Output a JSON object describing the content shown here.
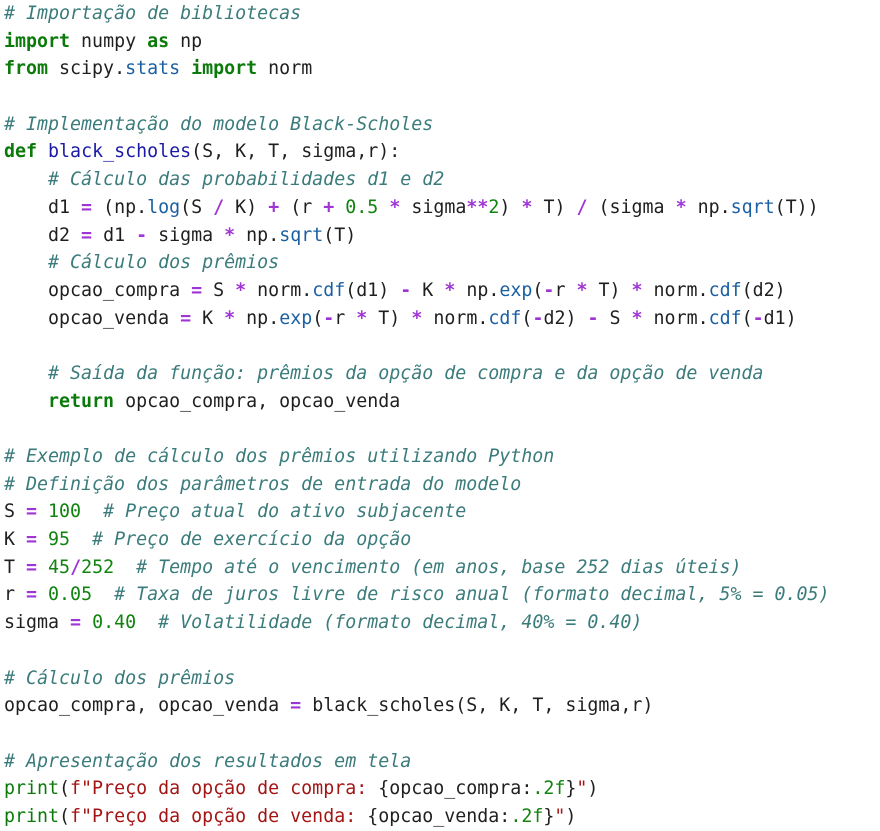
{
  "editor": {
    "language": "python",
    "lines": [
      [
        {
          "t": "cm",
          "v": "# Importação de bibliotecas"
        }
      ],
      [
        {
          "t": "kw",
          "v": "import"
        },
        {
          "t": "p",
          "v": " numpy "
        },
        {
          "t": "kw",
          "v": "as"
        },
        {
          "t": "p",
          "v": " np"
        }
      ],
      [
        {
          "t": "kw",
          "v": "from"
        },
        {
          "t": "p",
          "v": " scipy."
        },
        {
          "t": "attr",
          "v": "stats"
        },
        {
          "t": "p",
          "v": " "
        },
        {
          "t": "kw",
          "v": "import"
        },
        {
          "t": "p",
          "v": " norm"
        }
      ],
      [],
      [
        {
          "t": "cm",
          "v": "# Implementação do modelo Black-Scholes"
        }
      ],
      [
        {
          "t": "kw",
          "v": "def"
        },
        {
          "t": "p",
          "v": " "
        },
        {
          "t": "fn",
          "v": "black_scholes"
        },
        {
          "t": "p",
          "v": "(S, K, T, sigma,r):"
        }
      ],
      [
        {
          "t": "p",
          "v": "    "
        },
        {
          "t": "cm",
          "v": "# Cálculo das probabilidades d1 e d2"
        }
      ],
      [
        {
          "t": "p",
          "v": "    d1 "
        },
        {
          "t": "op",
          "v": "="
        },
        {
          "t": "p",
          "v": " (np."
        },
        {
          "t": "attr",
          "v": "log"
        },
        {
          "t": "p",
          "v": "(S "
        },
        {
          "t": "op",
          "v": "/"
        },
        {
          "t": "p",
          "v": " K) "
        },
        {
          "t": "op",
          "v": "+"
        },
        {
          "t": "p",
          "v": " (r "
        },
        {
          "t": "op",
          "v": "+"
        },
        {
          "t": "p",
          "v": " "
        },
        {
          "t": "num",
          "v": "0.5"
        },
        {
          "t": "p",
          "v": " "
        },
        {
          "t": "op",
          "v": "*"
        },
        {
          "t": "p",
          "v": " sigma"
        },
        {
          "t": "op",
          "v": "**"
        },
        {
          "t": "num",
          "v": "2"
        },
        {
          "t": "p",
          "v": ") "
        },
        {
          "t": "op",
          "v": "*"
        },
        {
          "t": "p",
          "v": " T) "
        },
        {
          "t": "op",
          "v": "/"
        },
        {
          "t": "p",
          "v": " (sigma "
        },
        {
          "t": "op",
          "v": "*"
        },
        {
          "t": "p",
          "v": " np."
        },
        {
          "t": "attr",
          "v": "sqrt"
        },
        {
          "t": "p",
          "v": "(T))"
        }
      ],
      [
        {
          "t": "p",
          "v": "    d2 "
        },
        {
          "t": "op",
          "v": "="
        },
        {
          "t": "p",
          "v": " d1 "
        },
        {
          "t": "op",
          "v": "-"
        },
        {
          "t": "p",
          "v": " sigma "
        },
        {
          "t": "op",
          "v": "*"
        },
        {
          "t": "p",
          "v": " np."
        },
        {
          "t": "attr",
          "v": "sqrt"
        },
        {
          "t": "p",
          "v": "(T)"
        }
      ],
      [
        {
          "t": "p",
          "v": "    "
        },
        {
          "t": "cm",
          "v": "# Cálculo dos prêmios"
        }
      ],
      [
        {
          "t": "p",
          "v": "    opcao_compra "
        },
        {
          "t": "op",
          "v": "="
        },
        {
          "t": "p",
          "v": " S "
        },
        {
          "t": "op",
          "v": "*"
        },
        {
          "t": "p",
          "v": " norm."
        },
        {
          "t": "attr",
          "v": "cdf"
        },
        {
          "t": "p",
          "v": "(d1) "
        },
        {
          "t": "op",
          "v": "-"
        },
        {
          "t": "p",
          "v": " K "
        },
        {
          "t": "op",
          "v": "*"
        },
        {
          "t": "p",
          "v": " np."
        },
        {
          "t": "attr",
          "v": "exp"
        },
        {
          "t": "p",
          "v": "("
        },
        {
          "t": "op",
          "v": "-"
        },
        {
          "t": "p",
          "v": "r "
        },
        {
          "t": "op",
          "v": "*"
        },
        {
          "t": "p",
          "v": " T) "
        },
        {
          "t": "op",
          "v": "*"
        },
        {
          "t": "p",
          "v": " norm."
        },
        {
          "t": "attr",
          "v": "cdf"
        },
        {
          "t": "p",
          "v": "(d2)"
        }
      ],
      [
        {
          "t": "p",
          "v": "    opcao_venda "
        },
        {
          "t": "op",
          "v": "="
        },
        {
          "t": "p",
          "v": " K "
        },
        {
          "t": "op",
          "v": "*"
        },
        {
          "t": "p",
          "v": " np."
        },
        {
          "t": "attr",
          "v": "exp"
        },
        {
          "t": "p",
          "v": "("
        },
        {
          "t": "op",
          "v": "-"
        },
        {
          "t": "p",
          "v": "r "
        },
        {
          "t": "op",
          "v": "*"
        },
        {
          "t": "p",
          "v": " T) "
        },
        {
          "t": "op",
          "v": "*"
        },
        {
          "t": "p",
          "v": " norm."
        },
        {
          "t": "attr",
          "v": "cdf"
        },
        {
          "t": "p",
          "v": "("
        },
        {
          "t": "op",
          "v": "-"
        },
        {
          "t": "p",
          "v": "d2) "
        },
        {
          "t": "op",
          "v": "-"
        },
        {
          "t": "p",
          "v": " S "
        },
        {
          "t": "op",
          "v": "*"
        },
        {
          "t": "p",
          "v": " norm."
        },
        {
          "t": "attr",
          "v": "cdf"
        },
        {
          "t": "p",
          "v": "("
        },
        {
          "t": "op",
          "v": "-"
        },
        {
          "t": "p",
          "v": "d1)"
        }
      ],
      [],
      [
        {
          "t": "p",
          "v": "    "
        },
        {
          "t": "cm",
          "v": "# Saída da função: prêmios da opção de compra e da opção de venda"
        }
      ],
      [
        {
          "t": "p",
          "v": "    "
        },
        {
          "t": "kw",
          "v": "return"
        },
        {
          "t": "p",
          "v": " opcao_compra, opcao_venda"
        }
      ],
      [],
      [
        {
          "t": "cm",
          "v": "# Exemplo de cálculo dos prêmios utilizando Python"
        }
      ],
      [
        {
          "t": "cm",
          "v": "# Definição dos parâmetros de entrada do modelo"
        }
      ],
      [
        {
          "t": "p",
          "v": "S "
        },
        {
          "t": "op",
          "v": "="
        },
        {
          "t": "p",
          "v": " "
        },
        {
          "t": "num",
          "v": "100"
        },
        {
          "t": "p",
          "v": "  "
        },
        {
          "t": "cm",
          "v": "# Preço atual do ativo subjacente"
        }
      ],
      [
        {
          "t": "p",
          "v": "K "
        },
        {
          "t": "op",
          "v": "="
        },
        {
          "t": "p",
          "v": " "
        },
        {
          "t": "num",
          "v": "95"
        },
        {
          "t": "p",
          "v": "  "
        },
        {
          "t": "cm",
          "v": "# Preço de exercício da opção"
        }
      ],
      [
        {
          "t": "p",
          "v": "T "
        },
        {
          "t": "op",
          "v": "="
        },
        {
          "t": "p",
          "v": " "
        },
        {
          "t": "num",
          "v": "45"
        },
        {
          "t": "op",
          "v": "/"
        },
        {
          "t": "num",
          "v": "252"
        },
        {
          "t": "p",
          "v": "  "
        },
        {
          "t": "cm",
          "v": "# Tempo até o vencimento (em anos, base 252 dias úteis)"
        }
      ],
      [
        {
          "t": "p",
          "v": "r "
        },
        {
          "t": "op",
          "v": "="
        },
        {
          "t": "p",
          "v": " "
        },
        {
          "t": "num",
          "v": "0.05"
        },
        {
          "t": "p",
          "v": "  "
        },
        {
          "t": "cm",
          "v": "# Taxa de juros livre de risco anual (formato decimal, 5% = 0.05)"
        }
      ],
      [
        {
          "t": "p",
          "v": "sigma "
        },
        {
          "t": "op",
          "v": "="
        },
        {
          "t": "p",
          "v": " "
        },
        {
          "t": "num",
          "v": "0.40"
        },
        {
          "t": "p",
          "v": "  "
        },
        {
          "t": "cm",
          "v": "# Volatilidade (formato decimal, 40% = 0.40)"
        }
      ],
      [],
      [
        {
          "t": "cm",
          "v": "# Cálculo dos prêmios"
        }
      ],
      [
        {
          "t": "p",
          "v": "opcao_compra, opcao_venda "
        },
        {
          "t": "op",
          "v": "="
        },
        {
          "t": "p",
          "v": " black_scholes(S, K, T, sigma,r)"
        }
      ],
      [],
      [
        {
          "t": "cm",
          "v": "# Apresentação dos resultados em tela"
        }
      ],
      [
        {
          "t": "bi",
          "v": "print"
        },
        {
          "t": "p",
          "v": "("
        },
        {
          "t": "str",
          "v": "f\"Preço da opção de compra: "
        },
        {
          "t": "p",
          "v": "{opcao_compra:"
        },
        {
          "t": "num",
          "v": ".2f"
        },
        {
          "t": "p",
          "v": "}"
        },
        {
          "t": "str",
          "v": "\""
        },
        {
          "t": "p",
          "v": ")"
        }
      ],
      [
        {
          "t": "bi",
          "v": "print"
        },
        {
          "t": "p",
          "v": "("
        },
        {
          "t": "str",
          "v": "f\"Preço da opção de venda: "
        },
        {
          "t": "p",
          "v": "{opcao_venda:"
        },
        {
          "t": "num",
          "v": ".2f"
        },
        {
          "t": "p",
          "v": "}"
        },
        {
          "t": "str",
          "v": "\""
        },
        {
          "t": "p",
          "v": ")"
        }
      ]
    ]
  }
}
